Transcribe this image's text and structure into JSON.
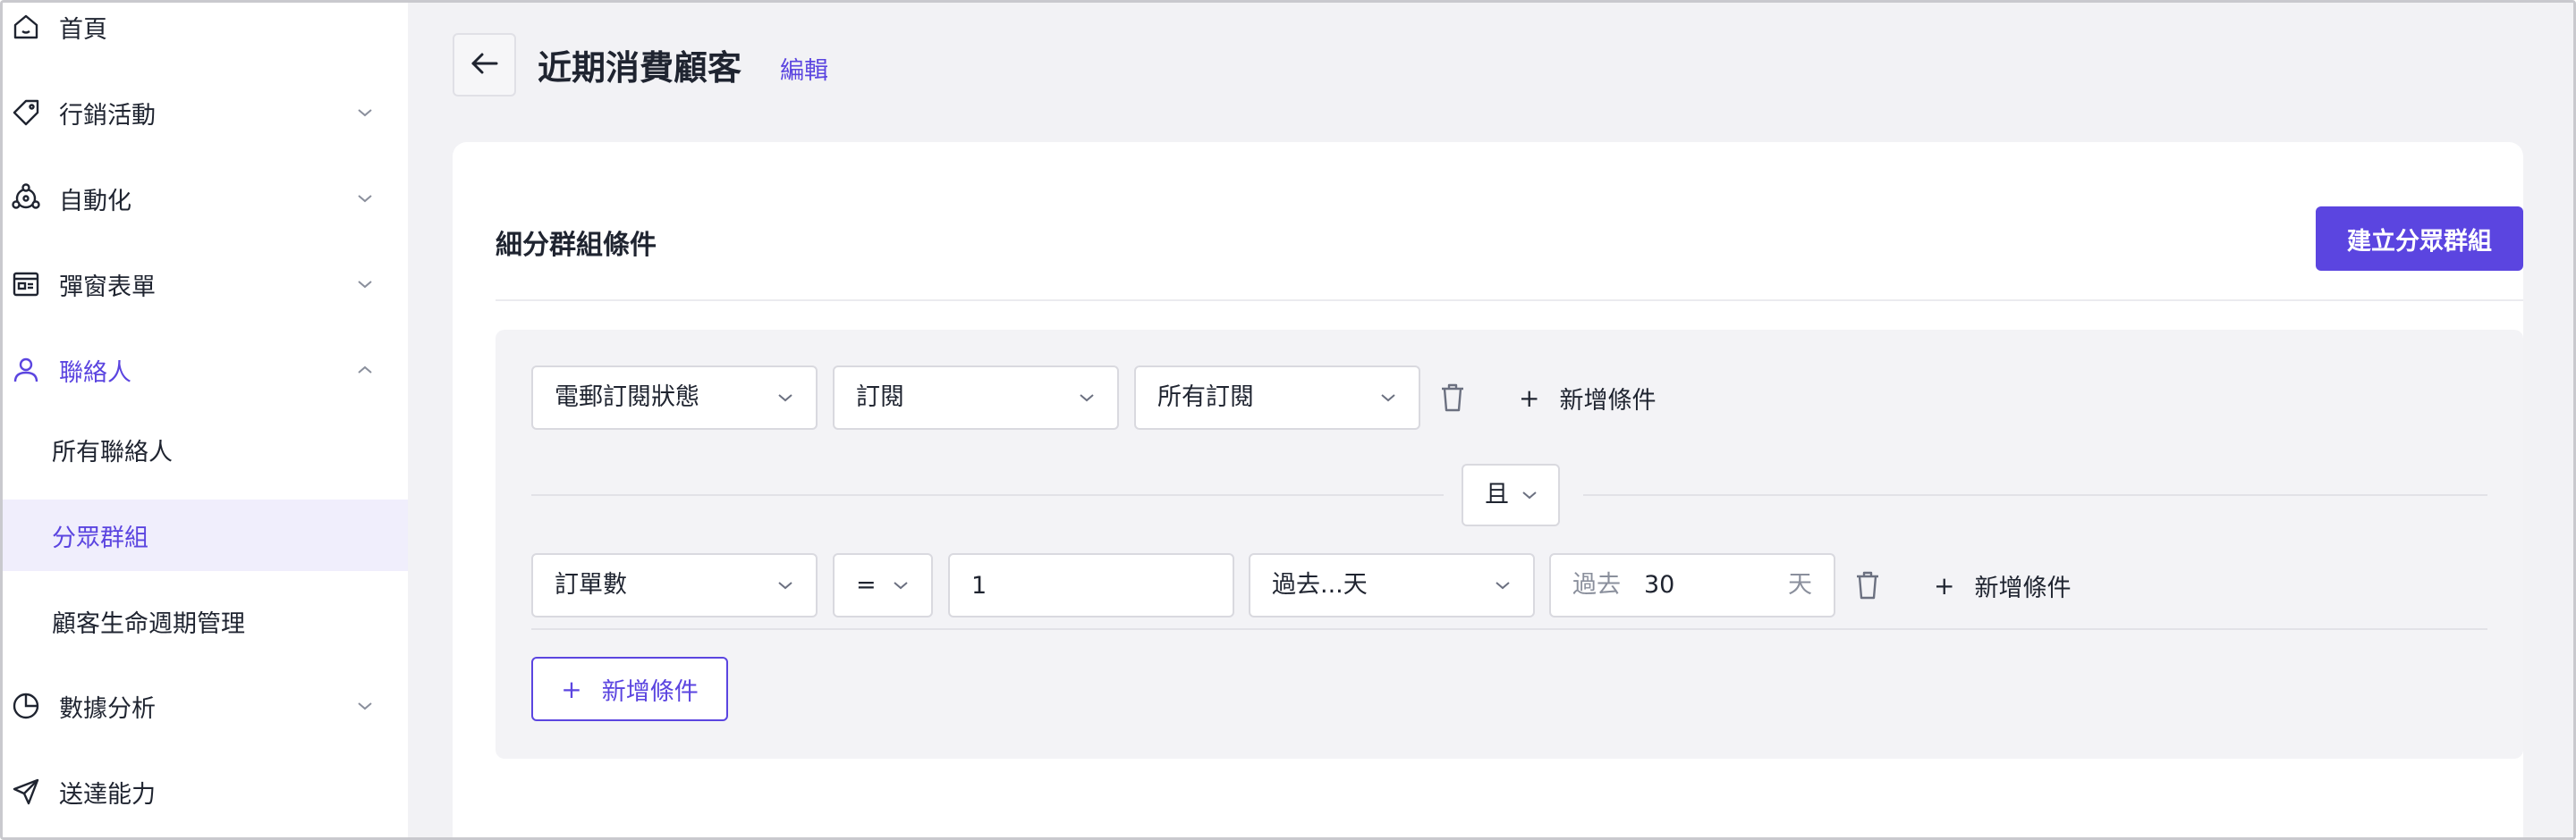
{
  "sidebar": {
    "items": [
      {
        "label": "首頁",
        "icon": "home-icon"
      },
      {
        "label": "行銷活動",
        "icon": "tag-icon"
      },
      {
        "label": "自動化",
        "icon": "automation-icon"
      },
      {
        "label": "彈窗表單",
        "icon": "form-window-icon"
      },
      {
        "label": "聯絡人",
        "icon": "user-icon"
      },
      {
        "label": "數據分析",
        "icon": "pie-chart-icon"
      },
      {
        "label": "送達能力",
        "icon": "send-icon"
      }
    ],
    "sub_items": [
      {
        "label": "所有聯絡人"
      },
      {
        "label": "分眾群組"
      },
      {
        "label": "顧客生命週期管理"
      }
    ]
  },
  "header": {
    "title": "近期消費顧客",
    "edit_label": "編輯"
  },
  "card": {
    "title": "細分群組條件",
    "create_button": "建立分眾群組"
  },
  "conditions": {
    "row1": {
      "field": "電郵訂閱狀態",
      "operator": "訂閱",
      "value": "所有訂閱",
      "add_label": "新增條件"
    },
    "join": "且",
    "row2": {
      "field": "訂單數",
      "operator": "=",
      "value": "1",
      "time_range": "過去...天",
      "days_prefix": "過去",
      "days_value": "30",
      "days_suffix": "天",
      "add_label": "新增條件"
    },
    "add_button": "新增條件",
    "plus": "+"
  },
  "colors": {
    "accent": "#5b45e0",
    "sidebar_selected_bg": "#f0eefc",
    "main_bg": "#f2f2f5"
  }
}
